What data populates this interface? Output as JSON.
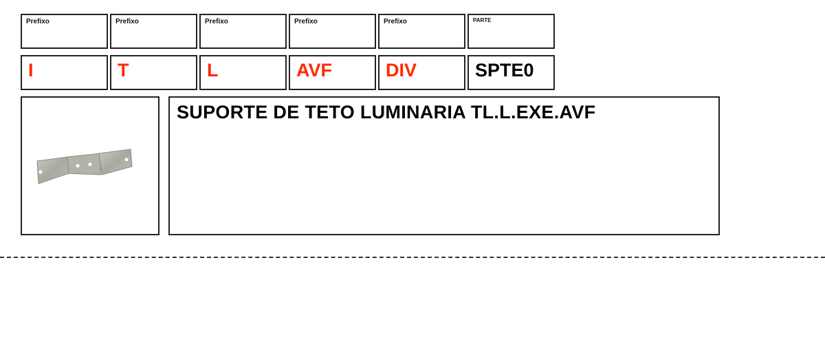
{
  "header_labels": [
    "Prefixo",
    "Prefixo",
    "Prefixo",
    "Prefixo",
    "Prefixo",
    "PARTE"
  ],
  "values": [
    {
      "text": "I",
      "color": "#ff2a00"
    },
    {
      "text": "T",
      "color": "#ff2a00"
    },
    {
      "text": "L",
      "color": "#ff2a00"
    },
    {
      "text": "AVF",
      "color": "#ff2a00"
    },
    {
      "text": "DIV",
      "color": "#ff2a00"
    },
    {
      "text": "SPTE0",
      "color": "#000000"
    }
  ],
  "description": "SUPORTE DE TETO LUMINARIA TL.L.EXE.AVF",
  "product_image": "metal-bracket-image"
}
